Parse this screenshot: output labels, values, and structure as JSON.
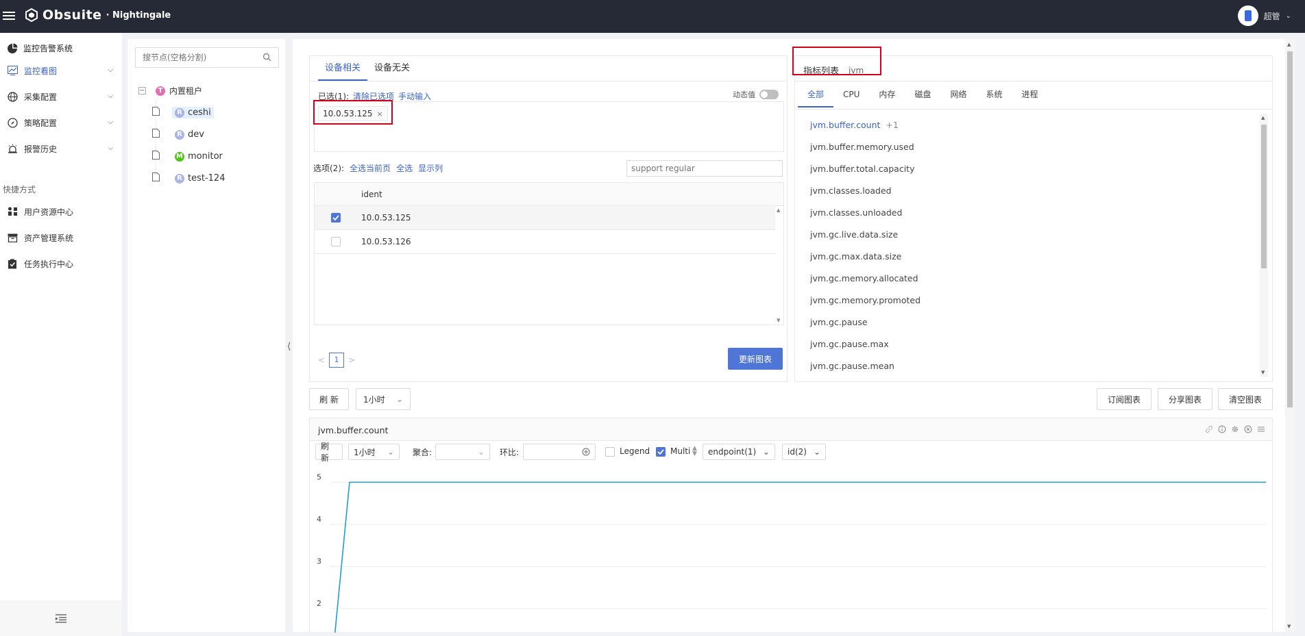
{
  "topbar": {
    "logo": "Obsuite",
    "logo_sub": "· Nightingale",
    "user_name": "超管"
  },
  "sidebar": {
    "system_title": "监控告警系统",
    "items": [
      {
        "label": "监控看图",
        "active": true
      },
      {
        "label": "采集配置"
      },
      {
        "label": "策略配置"
      },
      {
        "label": "报警历史"
      }
    ],
    "shortcut_label": "快捷方式",
    "shortcuts": [
      {
        "label": "用户资源中心"
      },
      {
        "label": "资产管理系统"
      },
      {
        "label": "任务执行中心"
      }
    ]
  },
  "tree": {
    "search_placeholder": "搜节点(空格分割)",
    "root": {
      "badge": "T",
      "label": "内置租户"
    },
    "nodes": [
      {
        "badge": "R",
        "label": "ceshi",
        "color": "#a9b3e8"
      },
      {
        "badge": "R",
        "label": "dev",
        "color": "#a9b3e8"
      },
      {
        "badge": "M",
        "label": "monitor",
        "color": "#52c41a"
      },
      {
        "badge": "R",
        "label": "test-124",
        "color": "#a9b3e8"
      }
    ]
  },
  "device": {
    "tabs": [
      "设备相关",
      "设备无关"
    ],
    "selected_label": "已选(1):",
    "clear_link": "清除已选项",
    "manual_link": "手动输入",
    "dynamic_label": "动态值",
    "selected_tag": "10.0.53.125",
    "options_label": "选项(2):",
    "select_page_link": "全选当前页",
    "select_all_link": "全选",
    "show_cols_link": "显示列",
    "filter_placeholder": "support regular",
    "table_header": "ident",
    "rows": [
      {
        "ident": "10.0.53.125",
        "checked": true
      },
      {
        "ident": "10.0.53.126",
        "checked": false
      }
    ],
    "page": "1",
    "update_button": "更新图表"
  },
  "metrics": {
    "title": "指标列表",
    "filter": "jvm",
    "categories": [
      "全部",
      "CPU",
      "内存",
      "磁盘",
      "网络",
      "系统",
      "进程"
    ],
    "first_item": "jvm.buffer.count",
    "first_item_suffix": "+1",
    "items": [
      "jvm.buffer.memory.used",
      "jvm.buffer.total.capacity",
      "jvm.classes.loaded",
      "jvm.classes.unloaded",
      "jvm.gc.live.data.size",
      "jvm.gc.max.data.size",
      "jvm.gc.memory.allocated",
      "jvm.gc.memory.promoted",
      "jvm.gc.pause",
      "jvm.gc.pause.max",
      "jvm.gc.pause.mean"
    ]
  },
  "toolbar": {
    "refresh": "刷 新",
    "range": "1小时",
    "subscribe": "订阅图表",
    "share": "分享图表",
    "clear": "清空图表"
  },
  "chart_panel": {
    "title": "jvm.buffer.count",
    "refresh": "刷 新",
    "range": "1小时",
    "agg_label": "聚合:",
    "ratio_label": "环比:",
    "legend_label": "Legend",
    "multi_label": "Multi",
    "endpoint_select": "endpoint(1)",
    "id_select": "id(2)"
  },
  "chart_data": {
    "type": "line",
    "y_ticks": [
      "5",
      "4",
      "3",
      "2"
    ],
    "ylim": [
      1.3,
      5.25
    ],
    "series": [
      {
        "color": "#1f9bd6",
        "values": [
          1.3,
          5.0,
          5.0
        ]
      }
    ]
  }
}
